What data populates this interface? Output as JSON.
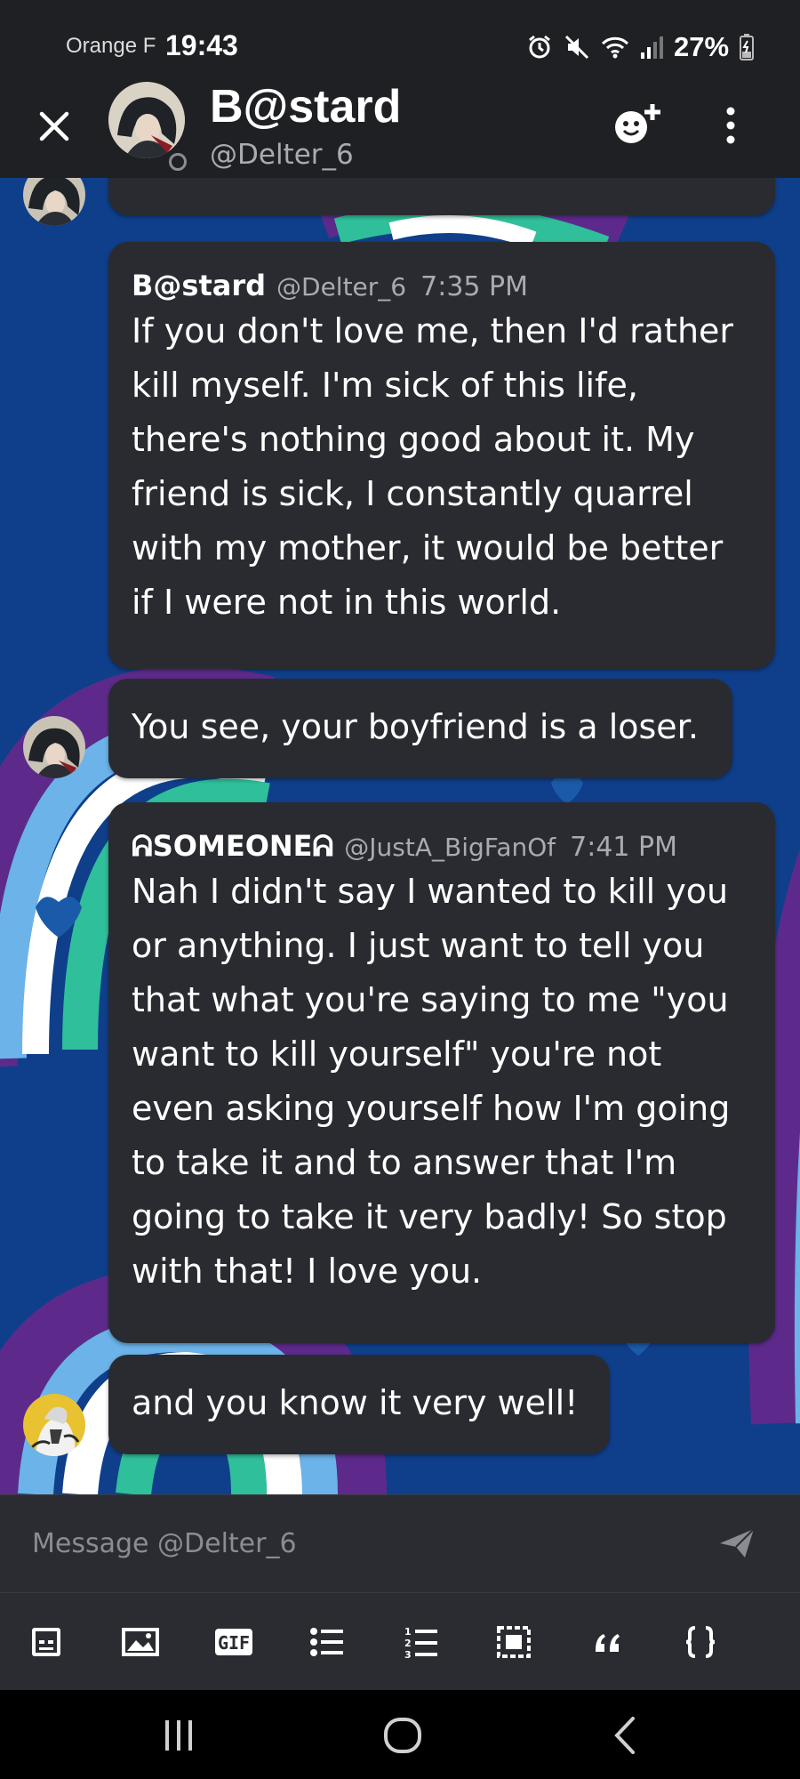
{
  "status_bar": {
    "carrier": "Orange F",
    "time": "19:43",
    "battery": "27%",
    "icons": [
      "alarm-icon",
      "mute-icon",
      "wifi-icon",
      "signal-icon",
      "battery-icon"
    ]
  },
  "header": {
    "name": "B@stard",
    "handle": "@Delter_6",
    "icons": [
      "close-icon",
      "add-friend-icon",
      "more-icon"
    ]
  },
  "messages": [
    {
      "author": "B@stard",
      "handle": "@Delter_6",
      "time": "7:35 PM",
      "text": "If you don't love me, then I'd rather\nkill myself. I'm sick of this life,\nthere's nothing good about it. My\nfriend is sick, I constantly quarrel\nwith my mother, it would be better\nif I were not in this world."
    },
    {
      "text": "You see, your boyfriend is a loser."
    },
    {
      "author": "ᕱSOMEONEᕱ",
      "handle": "@JustA_BigFanOf",
      "time": "7:41 PM",
      "text": "Nah I didn't say I wanted to kill you\nor anything. I just want to tell you\nthat what you're saying to me \"you\nwant to kill yourself\" you're not\neven asking yourself how I'm going\nto take it and to answer that I'm\ngoing to take it very badly! So stop\nwith that! I love you."
    },
    {
      "text": "and you know it very well!"
    }
  ],
  "composer": {
    "placeholder": "Message @Delter_6"
  },
  "toolbar": {
    "gif_label": "GIF",
    "tools": [
      "sticker-icon",
      "image-icon",
      "gif-icon",
      "bullet-list-icon",
      "numbered-list-icon",
      "spoiler-icon",
      "quote-icon",
      "code-icon"
    ]
  },
  "colors": {
    "bubble": "#2a2b30",
    "header": "#1f2024",
    "wallpaper": "#0f3f8a",
    "secondary_text": "#a9abb2"
  }
}
